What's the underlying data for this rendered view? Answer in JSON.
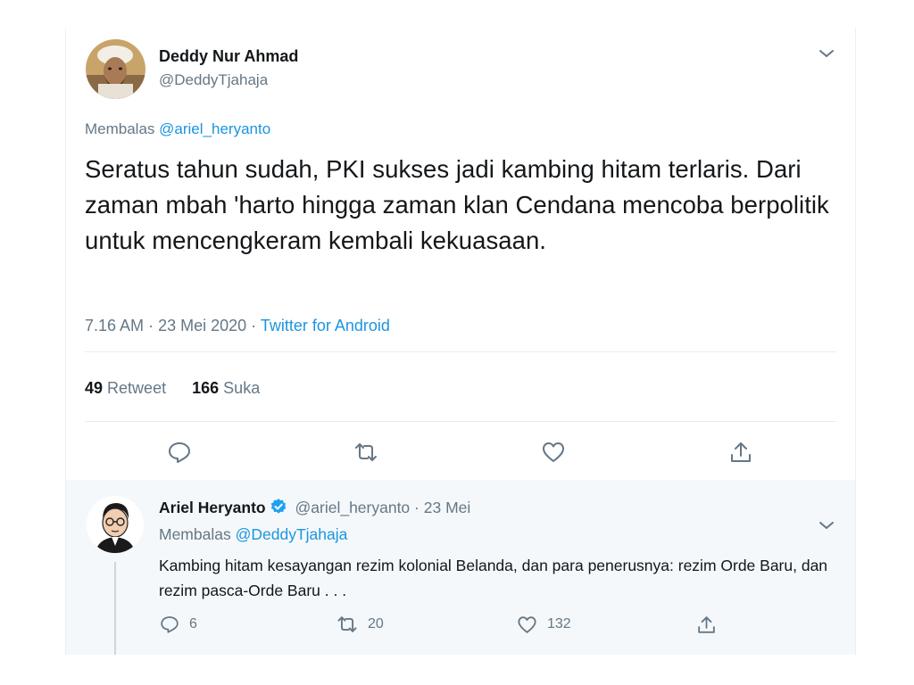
{
  "main_tweet": {
    "author_name": "Deddy Nur Ahmad",
    "author_handle": "@DeddyTjahaja",
    "reply_prefix": "Membalas",
    "reply_mention": "@ariel_heryanto",
    "text": "Seratus tahun sudah, PKI sukses jadi kambing hitam terlaris. Dari zaman mbah 'harto hingga zaman klan Cendana mencoba berpolitik untuk mencengkeram kembali kekuasaan.",
    "time": "7.16 AM",
    "date": "23 Mei 2020",
    "separator": "·",
    "source": "Twitter for Android",
    "retweet_count": "49",
    "retweet_label": "Retweet",
    "like_count": "166",
    "like_label": "Suka"
  },
  "reply_tweet": {
    "author_name": "Ariel Heryanto",
    "author_handle": "@ariel_heryanto",
    "date": "23 Mei",
    "separator": "·",
    "reply_prefix": "Membalas",
    "reply_mention": "@DeddyTjahaja",
    "text": "Kambing hitam kesayangan rezim kolonial Belanda, dan para penerusnya: rezim Orde Baru, dan rezim pasca-Orde Baru . . .",
    "reply_count": "6",
    "retweet_count": "20",
    "like_count": "132"
  },
  "icons": {
    "menu": "chevron-down-icon",
    "reply": "speech-bubble-icon",
    "retweet": "retweet-arrows-icon",
    "like": "heart-icon",
    "share": "share-upload-icon",
    "verified": "verified-badge-icon"
  },
  "colors": {
    "link": "#1b95e0",
    "secondary_text": "#657786",
    "primary_text": "#14171a",
    "reply_background": "#f5f8fa",
    "verified": "#1da1f2"
  }
}
